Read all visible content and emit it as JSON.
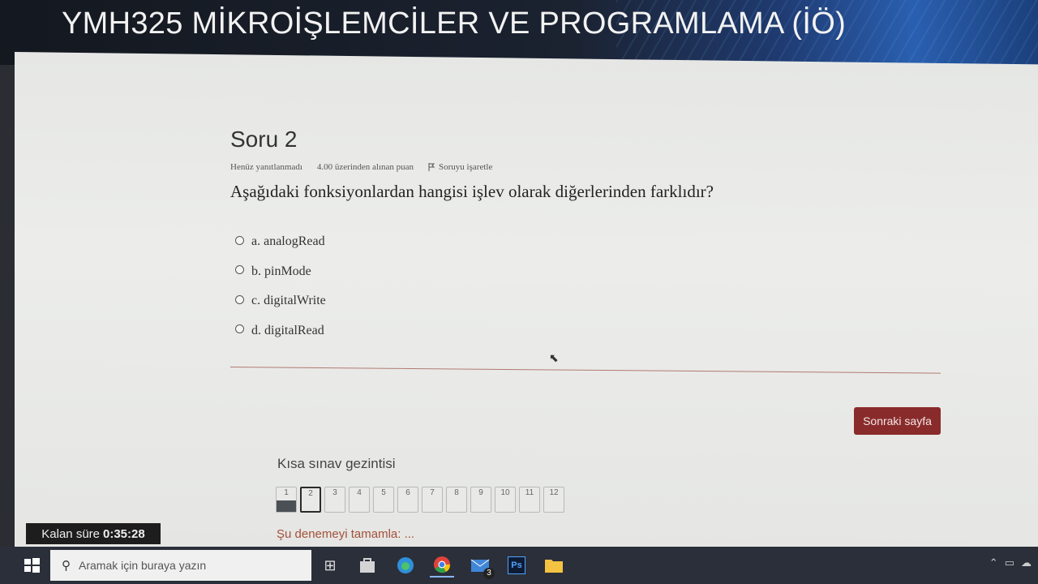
{
  "header": {
    "title": "YMH325 MİKROİŞLEMCİLER VE PROGRAMLAMA (İÖ)"
  },
  "question": {
    "heading": "Soru 2",
    "status": "Henüz yanıtlanmadı",
    "points": "4.00 üzerinden alınan puan",
    "flag_label": "Soruyu işaretle",
    "text": "Aşağıdaki fonksiyonlardan hangisi işlev olarak diğerlerinden farklıdır?",
    "options": [
      {
        "label": "a. analogRead"
      },
      {
        "label": "b. pinMode"
      },
      {
        "label": "c. digitalWrite"
      },
      {
        "label": "d. digitalRead"
      }
    ]
  },
  "next_button": "Sonraki sayfa",
  "quiz_nav": {
    "title": "Kısa sınav gezintisi",
    "items": [
      "1",
      "2",
      "3",
      "4",
      "5",
      "6",
      "7",
      "8",
      "9",
      "10",
      "11",
      "12"
    ],
    "answered": [
      "1"
    ],
    "current": "2",
    "finish_link": "Şu denemeyi tamamla: ..."
  },
  "timer": {
    "label": "Kalan süre",
    "value": "0:35:28"
  },
  "taskbar": {
    "search_placeholder": "Aramak için buraya yazın",
    "mail_badge": "3",
    "icons": [
      "windows-icon",
      "task-view-icon",
      "store-icon",
      "edge-icon",
      "chrome-icon",
      "mail-icon",
      "photoshop-icon",
      "file-explorer-icon"
    ]
  },
  "colors": {
    "accent": "#8a2b2b",
    "link": "#a3503a",
    "taskbar": "#2b2f3a"
  }
}
